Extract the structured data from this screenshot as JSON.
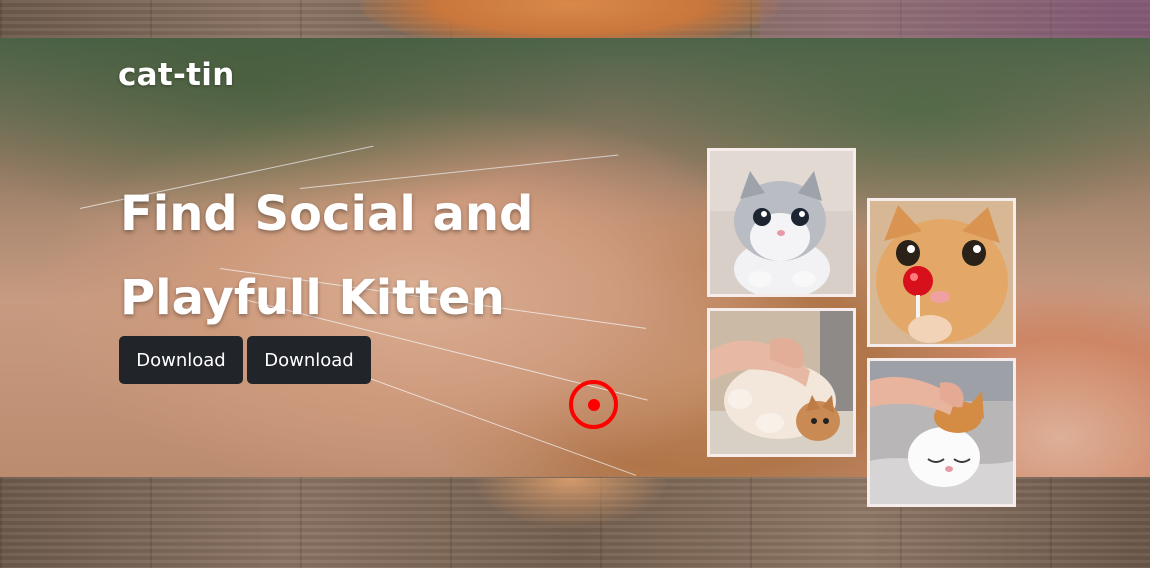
{
  "brand": {
    "name": "cat-tin"
  },
  "hero": {
    "headline_line1": "Find Social and",
    "headline_line2": "Playfull Kitten",
    "buttons": [
      {
        "label": "Download"
      },
      {
        "label": "Download"
      }
    ]
  },
  "gallery": {
    "photos": [
      {
        "subject": "grey and white kitten"
      },
      {
        "subject": "orange cat licking lollipop"
      },
      {
        "subject": "hands petting kitten on its back"
      },
      {
        "subject": "hand petting white and orange kitten"
      }
    ]
  },
  "colors": {
    "button_bg": "#212529",
    "button_text": "#ffffff",
    "heading_text": "#ffffff",
    "photo_border": "#f6ecec",
    "cursor_marker": "#ff0000"
  },
  "icons": {
    "cursor_marker": "click-target-icon"
  }
}
